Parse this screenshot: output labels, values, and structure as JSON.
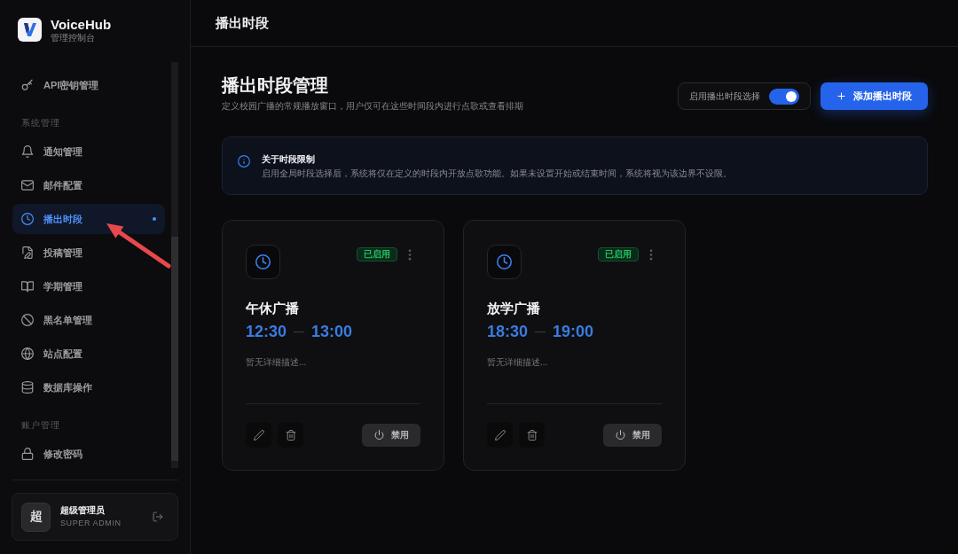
{
  "brand": {
    "name": "VoiceHub",
    "subtitle": "管理控制台"
  },
  "sidebar": {
    "groups": [
      {
        "items": [
          {
            "label": "API密钥管理",
            "selected": false
          }
        ]
      },
      {
        "title": "系统管理",
        "items": [
          {
            "label": "通知管理",
            "selected": false
          },
          {
            "label": "邮件配置",
            "selected": false
          },
          {
            "label": "播出时段",
            "selected": true
          },
          {
            "label": "投稿管理",
            "selected": false
          },
          {
            "label": "学期管理",
            "selected": false
          },
          {
            "label": "黑名单管理",
            "selected": false
          },
          {
            "label": "站点配置",
            "selected": false
          },
          {
            "label": "数据库操作",
            "selected": false
          }
        ]
      },
      {
        "title": "账户管理",
        "items": [
          {
            "label": "修改密码",
            "selected": false
          }
        ]
      }
    ]
  },
  "user": {
    "avatar": "超",
    "name": "超级管理员",
    "role": "SUPER ADMIN"
  },
  "header": {
    "title": "播出时段"
  },
  "page": {
    "title": "播出时段管理",
    "subtitle": "定义校园广播的常规播放窗口，用户仅可在这些时间段内进行点歌或查看排期",
    "toggle": {
      "label": "启用播出时段选择",
      "on": true
    },
    "add_button": {
      "label": "添加播出时段"
    }
  },
  "notice": {
    "title": "关于时段限制",
    "text": "启用全局时段选择后，系统将仅在定义的时段内开放点歌功能。如果未设置开始或结束时间，系统将视为该边界不设限。"
  },
  "slots": [
    {
      "name": "午休广播",
      "start": "12:30",
      "end": "13:00",
      "description": "暂无详细描述...",
      "status": "已启用",
      "enabled": true,
      "action": "禁用"
    },
    {
      "name": "放学广播",
      "start": "18:30",
      "end": "19:00",
      "description": "暂无详细描述...",
      "status": "已启用",
      "enabled": true,
      "action": "禁用"
    }
  ]
}
